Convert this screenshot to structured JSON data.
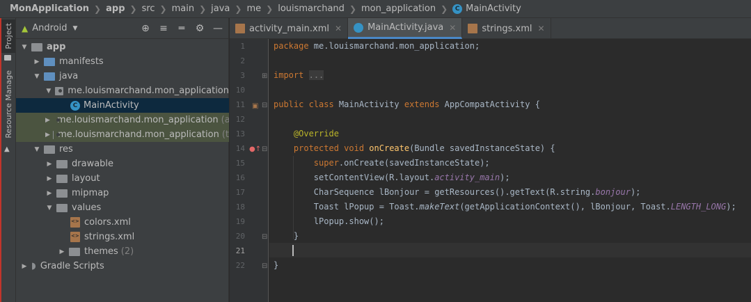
{
  "breadcrumb": {
    "project": "MonApplication",
    "items": [
      "app",
      "src",
      "main",
      "java",
      "me",
      "louismarchand",
      "mon_application"
    ],
    "file": "MainActivity"
  },
  "tool_strip": {
    "project_tab": "Project",
    "resource_tab": "Resource Manage"
  },
  "project_panel": {
    "view": "Android",
    "tree": {
      "app": "app",
      "manifests": "manifests",
      "java": "java",
      "pkg_main": "me.louismarchand.mon_application",
      "main_activity": "MainActivity",
      "pkg_test1": "me.louismarchand.mon_application",
      "pkg_test1_suffix": "(a",
      "pkg_test2": "me.louismarchand.mon_application",
      "pkg_test2_suffix": "(t",
      "res": "res",
      "drawable": "drawable",
      "layout": "layout",
      "mipmap": "mipmap",
      "values": "values",
      "colors": "colors.xml",
      "strings": "strings.xml",
      "themes": "themes",
      "themes_count": "(2)",
      "gradle": "Gradle Scripts"
    }
  },
  "tabs": [
    {
      "label": "activity_main.xml",
      "icon": "xml-file-icon"
    },
    {
      "label": "MainActivity.java",
      "icon": "java-class-icon",
      "active": true
    },
    {
      "label": "strings.xml",
      "icon": "xml-file-icon"
    }
  ],
  "editor": {
    "line_numbers": [
      "1",
      "2",
      "3",
      "10",
      "11",
      "12",
      "13",
      "14",
      "15",
      "16",
      "17",
      "18",
      "19",
      "20",
      "21",
      "22"
    ],
    "current_line": "21",
    "code": {
      "l1_kw": "package",
      "l1_rest": " me.louismarchand.mon_application;",
      "l3_kw": "import",
      "l3_fold": "...",
      "l11_kw": "public class",
      "l11_name": " MainActivity ",
      "l11_ext": "extends",
      "l11_rest": " AppCompatActivity {",
      "l13_ann": "@Override",
      "l14_kw": "protected void",
      "l14_fn": "onCreate",
      "l14_rest": "(Bundle savedInstanceState) {",
      "l15_kw": "super",
      "l15_rest": ".onCreate(savedInstanceState);",
      "l16_a": "setContentView(R.layout.",
      "l16_it": "activity_main",
      "l16_b": ");",
      "l17_a": "CharSequence lBonjour = getResources().getText(R.string.",
      "l17_it": "bonjour",
      "l17_b": ");",
      "l18_a": "Toast lPopup = Toast.",
      "l18_it1": "makeText",
      "l18_b": "(getApplicationContext(), lBonjour, Toast.",
      "l18_it2": "LENGTH_LONG",
      "l18_c": ");",
      "l19": "lPopup.show();",
      "l20": "}",
      "l22": "}"
    }
  },
  "colors": {
    "accent": "#4a88c7",
    "keyword": "#cc7832",
    "annotation": "#bbb529",
    "function": "#ffc66d",
    "field": "#9876aa"
  }
}
